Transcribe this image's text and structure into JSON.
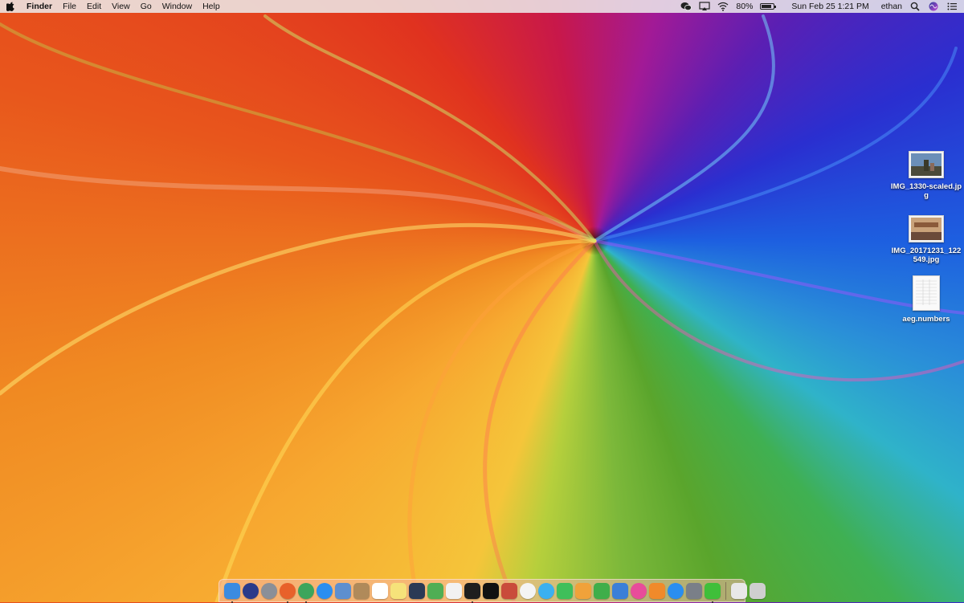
{
  "menubar": {
    "app_name": "Finder",
    "menus": [
      "File",
      "Edit",
      "View",
      "Go",
      "Window",
      "Help"
    ],
    "battery_percent": "80%",
    "battery_level": 0.8,
    "clock": "Sun Feb 25  1:21 PM",
    "user": "ethan",
    "status_icons": [
      "wechat-icon",
      "airplay-icon",
      "wifi-icon",
      "battery-icon",
      "search-icon",
      "siri-icon",
      "notification-center-icon"
    ]
  },
  "desktop_icons": [
    {
      "label": "IMG_1330-scaled.jpg",
      "type": "image"
    },
    {
      "label": "IMG_20171231_122549.jpg",
      "type": "image"
    },
    {
      "label": "aeg.numbers",
      "type": "numbers-document"
    }
  ],
  "dock": {
    "apps": [
      {
        "name": "finder-icon",
        "color": "#3b8be0",
        "running": true
      },
      {
        "name": "siri-icon",
        "color": "#2a3a8a",
        "running": false
      },
      {
        "name": "launchpad-icon",
        "color": "#8a8f98",
        "running": false
      },
      {
        "name": "firefox-icon",
        "color": "#e8612a",
        "running": true
      },
      {
        "name": "chrome-icon",
        "color": "#3ca55c",
        "running": true
      },
      {
        "name": "safari-icon",
        "color": "#2a8ef0",
        "running": false
      },
      {
        "name": "preview-icon",
        "color": "#5d8fcf",
        "running": false
      },
      {
        "name": "contacts-icon",
        "color": "#b08a5a",
        "running": false
      },
      {
        "name": "calendar-icon",
        "color": "#ffffff",
        "running": false
      },
      {
        "name": "notes-icon",
        "color": "#f6e27a",
        "running": false
      },
      {
        "name": "xcode-instruments-icon",
        "color": "#2b3a55",
        "running": false
      },
      {
        "name": "maps-icon",
        "color": "#4fae54",
        "running": false
      },
      {
        "name": "reminders-icon",
        "color": "#f2f2f2",
        "running": false
      },
      {
        "name": "terminal-icon",
        "color": "#1e1e1e",
        "running": true
      },
      {
        "name": "intellij-icon",
        "color": "#111111",
        "running": false
      },
      {
        "name": "photo-booth-icon",
        "color": "#c94b3b",
        "running": false
      },
      {
        "name": "photos-icon",
        "color": "#f4f4f4",
        "running": false
      },
      {
        "name": "messages-icon",
        "color": "#3bb0f0",
        "running": false
      },
      {
        "name": "facetime-icon",
        "color": "#3fbf5a",
        "running": false
      },
      {
        "name": "pages-icon",
        "color": "#f0a23a",
        "running": false
      },
      {
        "name": "numbers-icon",
        "color": "#3fae4a",
        "running": false
      },
      {
        "name": "keynote-icon",
        "color": "#3a7fd8",
        "running": false
      },
      {
        "name": "itunes-icon",
        "color": "#e84c9a",
        "running": false
      },
      {
        "name": "ibooks-icon",
        "color": "#f08a2a",
        "running": false
      },
      {
        "name": "app-store-icon",
        "color": "#2a8ef0",
        "running": false
      },
      {
        "name": "system-preferences-icon",
        "color": "#7a7f88",
        "running": false
      },
      {
        "name": "wechat-icon",
        "color": "#3fbf3a",
        "running": true
      }
    ],
    "right_items": [
      {
        "name": "downloads-stack-icon",
        "color": "#e8e8e8"
      },
      {
        "name": "trash-icon",
        "color": "#cfcfcf"
      }
    ]
  }
}
